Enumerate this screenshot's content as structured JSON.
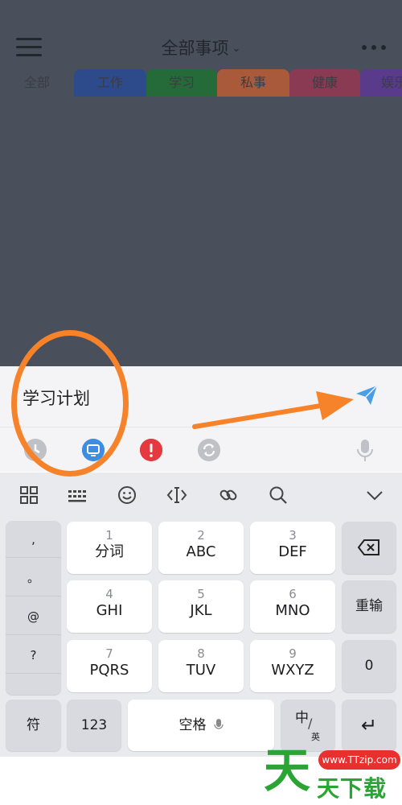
{
  "header": {
    "title": "全部事项",
    "title_caret": "⌄"
  },
  "tabs": [
    {
      "label": "全部",
      "color": "#4a4f5c"
    },
    {
      "label": "工作",
      "color": "#2d4a8a"
    },
    {
      "label": "学习",
      "color": "#256b3a"
    },
    {
      "label": "私事",
      "color": "#a85a3a"
    },
    {
      "label": "健康",
      "color": "#8a3a52"
    },
    {
      "label": "娱乐",
      "color": "#5a3a8a"
    }
  ],
  "input": {
    "value": "学习计划"
  },
  "quick_icons": [
    "clock-icon",
    "monitor-icon",
    "important-icon",
    "repeat-icon",
    "microphone-icon"
  ],
  "toolbar": [
    "grid-icon",
    "keyboard-icon",
    "emoji-icon",
    "cursor-icon",
    "link-icon",
    "search-icon",
    "collapse-icon"
  ],
  "keyboard": {
    "punct": [
      ",",
      "。",
      "@",
      "?",
      ""
    ],
    "rows": [
      [
        {
          "num": "1",
          "label": "分词"
        },
        {
          "num": "2",
          "label": "ABC"
        },
        {
          "num": "3",
          "label": "DEF"
        }
      ],
      [
        {
          "num": "4",
          "label": "GHI"
        },
        {
          "num": "5",
          "label": "JKL"
        },
        {
          "num": "6",
          "label": "MNO"
        }
      ],
      [
        {
          "num": "7",
          "label": "PQRS"
        },
        {
          "num": "8",
          "label": "TUV"
        },
        {
          "num": "9",
          "label": "WXYZ"
        }
      ]
    ],
    "reenter": "重输",
    "zero": "0",
    "symbol": "符",
    "numeric": "123",
    "space": "空格",
    "lang_main": "中",
    "lang_sub": "英",
    "enter_symbol": "↵"
  },
  "colors": {
    "accent_orange": "#f6822a",
    "send_blue": "#4a9ee6",
    "important_red": "#e6383f"
  },
  "watermark": {
    "big": "天",
    "url": "www.TTzip.com",
    "small": "天下载"
  }
}
